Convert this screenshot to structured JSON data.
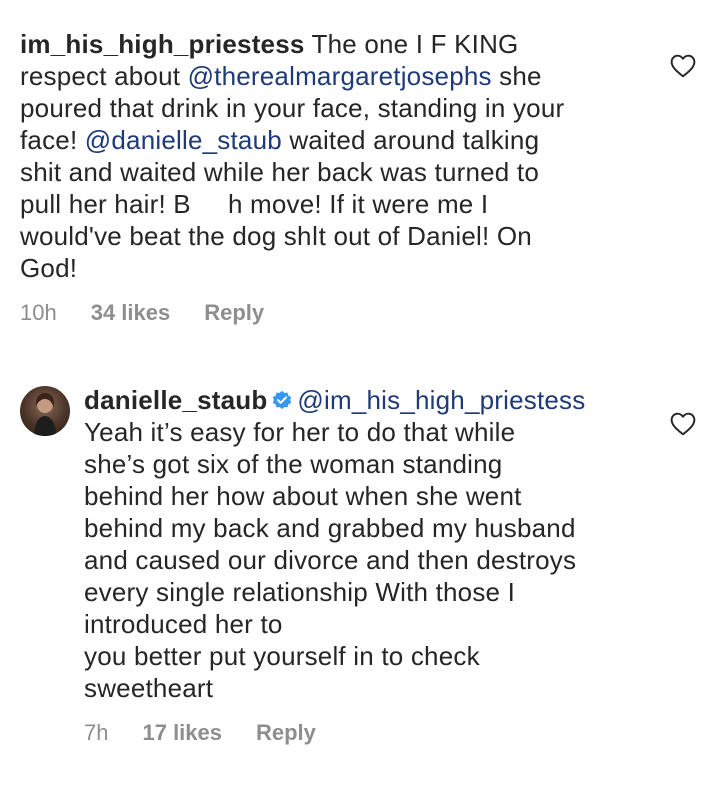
{
  "comment": {
    "username": "im_his_high_priestess",
    "text_lines": [
      "The one I F     KING",
      "respect about ",
      " she",
      "poured that drink in your face, standing in your",
      "face! ",
      " waited around talking",
      "shit and waited while her back was turned to",
      "pull her hair! B     h move! If it were me I",
      "would've beat the dog shǀt out of Daniel! On",
      "God!"
    ],
    "mention_1": "@therealmargaretjosephs",
    "mention_2": "@danielle_staub",
    "time": "10h",
    "likes": "34 likes",
    "reply_label": "Reply",
    "like_icon": "heart-outline-icon"
  },
  "reply": {
    "username": "danielle_staub",
    "verified_icon": "verified-badge-icon",
    "mention": "@im_his_high_priestess",
    "text_lines": [
      "Yeah it’s easy for her to do that while",
      "she’s got six of the woman standing",
      "behind her how about when she went",
      "behind my back and grabbed my husband",
      "and caused our divorce and then destroys",
      "every single relationship With those I",
      "introduced her to",
      "you better put yourself in to check",
      "sweetheart"
    ],
    "time": "7h",
    "likes": "17 likes",
    "reply_label": "Reply",
    "like_icon": "heart-outline-icon"
  },
  "colors": {
    "text": "#262626",
    "mention": "#1e3a78",
    "meta": "#8e8e8e",
    "verified": "#3897f0"
  }
}
